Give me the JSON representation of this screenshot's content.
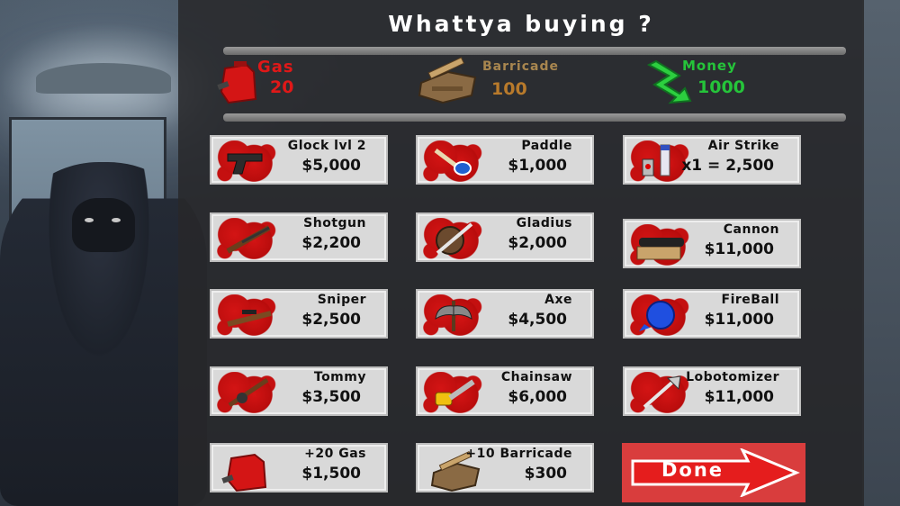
{
  "shop": {
    "title": "Whattya buying ?",
    "stats": {
      "gas": {
        "label": "Gas",
        "value": "20",
        "icon": "gas-can-icon"
      },
      "barricade": {
        "label": "Barricade",
        "value": "100",
        "icon": "barricade-icon"
      },
      "money": {
        "label": "Money",
        "value": "1000",
        "icon": "money-icon"
      }
    },
    "items": [
      {
        "name": "Glock lvl 2",
        "price": "$5,000",
        "icon": "pistol-icon"
      },
      {
        "name": "Paddle",
        "price": "$1,000",
        "icon": "paddle-icon"
      },
      {
        "name": "Air Strike",
        "price": "x1 = 2,500",
        "icon": "air-strike-icon"
      },
      {
        "name": "Shotgun",
        "price": "$2,200",
        "icon": "shotgun-icon"
      },
      {
        "name": "Gladius",
        "price": "$2,000",
        "icon": "gladius-icon"
      },
      {
        "name": "Cannon",
        "price": "$11,000",
        "icon": "cannon-icon"
      },
      {
        "name": "Sniper",
        "price": "$2,500",
        "icon": "sniper-icon"
      },
      {
        "name": "Axe",
        "price": "$4,500",
        "icon": "axe-icon"
      },
      {
        "name": "FireBall",
        "price": "$11,000",
        "icon": "fireball-icon"
      },
      {
        "name": "Tommy",
        "price": "$3,500",
        "icon": "tommy-gun-icon"
      },
      {
        "name": "Chainsaw",
        "price": "$6,000",
        "icon": "chainsaw-icon"
      },
      {
        "name": "Lobotomizer",
        "price": "$11,000",
        "icon": "lobotomizer-icon"
      },
      {
        "name": "+20 Gas",
        "price": "$1,500",
        "icon": "gas-can-icon"
      },
      {
        "name": "+10 Barricade",
        "price": "$300",
        "icon": "barricade-icon"
      }
    ],
    "done_label": "Done",
    "colors": {
      "gas": "#e01818",
      "barricade": "#b87a2b",
      "money": "#25c43a",
      "done_button": "#d93d3d"
    }
  }
}
